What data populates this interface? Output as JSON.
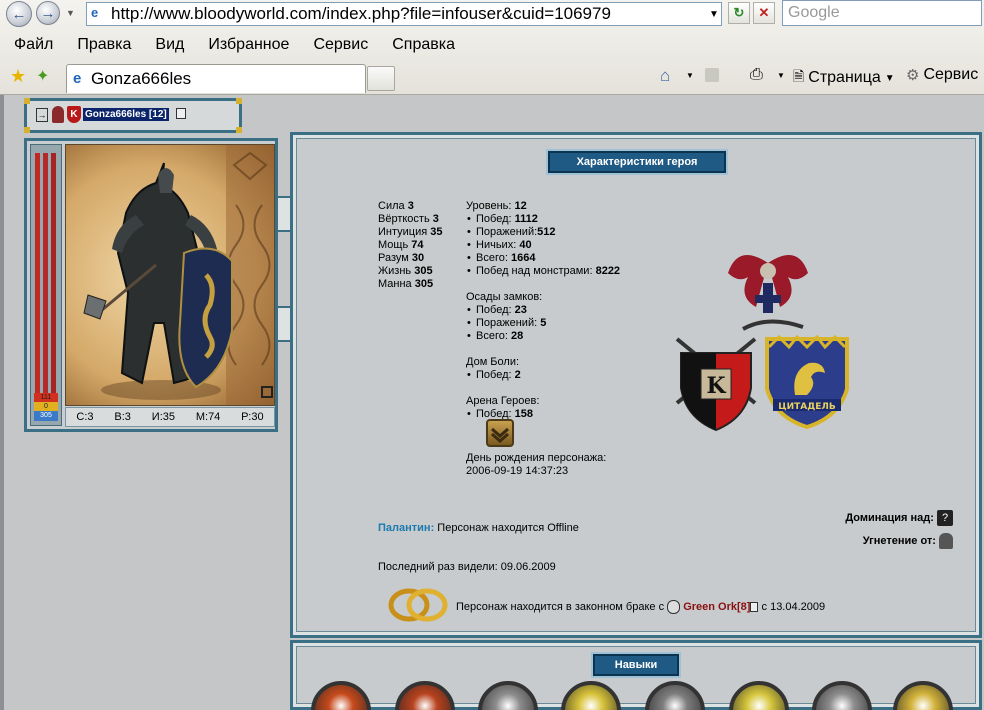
{
  "browser": {
    "address": "http://www.bloodyworld.com/index.php?file=infouser&cuid=106979",
    "search_placeholder": "Google",
    "menu": [
      "Файл",
      "Правка",
      "Вид",
      "Избранное",
      "Сервис",
      "Справка"
    ],
    "tab_title": "Gonza666les",
    "cmd_page": "Страница",
    "cmd_service": "Сервис"
  },
  "hero": {
    "nick": "Gonza666les [12]",
    "bar_values": [
      "111",
      "0",
      "305"
    ],
    "stats_line": [
      "С:3",
      "В:3",
      "И:35",
      "М:74",
      "Р:30"
    ]
  },
  "panel": {
    "title": "Характеристики героя",
    "attributes": [
      {
        "label": "Сила",
        "value": "3"
      },
      {
        "label": "Вёрткость",
        "value": "3"
      },
      {
        "label": "Интуиция",
        "value": "35"
      },
      {
        "label": "Мощь",
        "value": "74"
      },
      {
        "label": "Разум",
        "value": "30"
      },
      {
        "label": "Жизнь",
        "value": "305"
      },
      {
        "label": "Манна",
        "value": "305"
      }
    ],
    "level_label": "Уровень:",
    "level_value": "12",
    "battles": [
      {
        "label": "Побед:",
        "value": "1112"
      },
      {
        "label": "Поражений:",
        "value": "512"
      },
      {
        "label": "Ничьих:",
        "value": "40"
      },
      {
        "label": "Всего:",
        "value": "1664"
      },
      {
        "label": "Побед над монстрами:",
        "value": "8222"
      }
    ],
    "sieges_label": "Осады замков:",
    "sieges": [
      {
        "label": "Побед:",
        "value": "23"
      },
      {
        "label": "Поражений:",
        "value": "5"
      },
      {
        "label": "Всего:",
        "value": "28"
      }
    ],
    "pain_label": "Дом Боли:",
    "pain": [
      {
        "label": "Побед:",
        "value": "2"
      }
    ],
    "arena_label": "Арена Героев:",
    "arena": [
      {
        "label": "Побед:",
        "value": "158"
      }
    ],
    "birthday_label": "День рождения персонажа:",
    "birthday_value": "2006-09-19 14:37:23",
    "palantir_label": "Палантин:",
    "palantir_text": "Персонаж находится Offline",
    "domination_label": "Доминация над:",
    "oppression_label": "Угнетение от:",
    "last_seen": "Последний раз видели: 09.06.2009",
    "marriage_text": "Персонаж находится в законном браке с",
    "spouse": "Green Ork[8]",
    "marriage_date": "с 13.04.2009",
    "emblem_k": "K",
    "citadel_text": "ЦИТАДЕЛЬ"
  },
  "skills": {
    "title": "Навыки",
    "medal_colors": [
      "#c64a1c",
      "#b8421e",
      "#8c8c8c",
      "#d7c23a",
      "#7d7d7d",
      "#d6c63c",
      "#8d8d8d",
      "#d2b23a"
    ]
  }
}
